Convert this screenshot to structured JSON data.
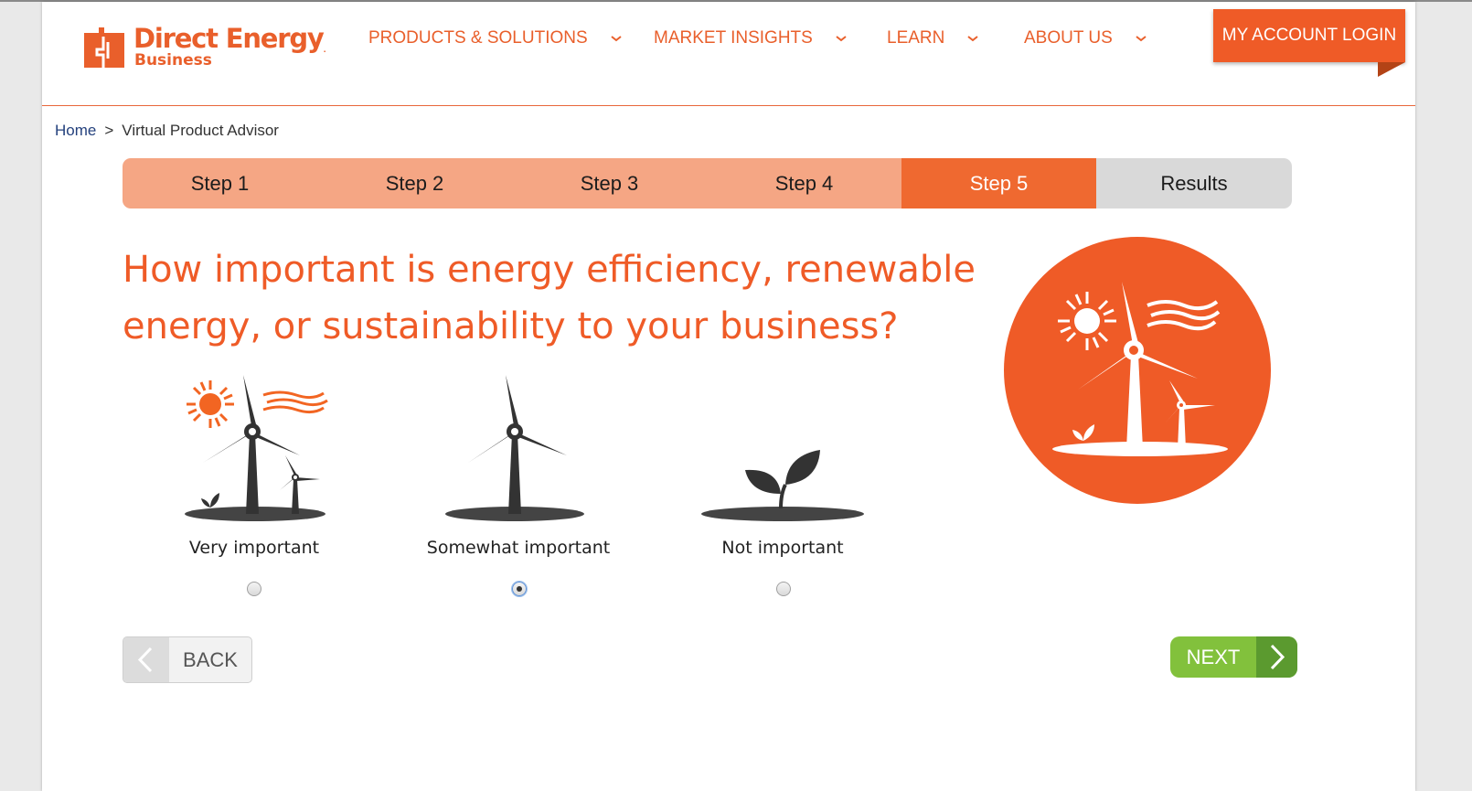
{
  "header": {
    "logo": {
      "name": "Direct Energy",
      "sub": "Business",
      "trademark": "."
    },
    "nav": [
      {
        "label": "PRODUCTS & SOLUTIONS"
      },
      {
        "label": "MARKET INSIGHTS"
      },
      {
        "label": "LEARN"
      },
      {
        "label": "ABOUT US"
      }
    ],
    "account_button": "MY ACCOUNT LOGIN"
  },
  "breadcrumb": {
    "home": "Home",
    "separator": ">",
    "current": "Virtual Product Advisor"
  },
  "steps": [
    {
      "label": "Step 1",
      "state": "completed"
    },
    {
      "label": "Step 2",
      "state": "completed"
    },
    {
      "label": "Step 3",
      "state": "completed"
    },
    {
      "label": "Step 4",
      "state": "completed"
    },
    {
      "label": "Step 5",
      "state": "active"
    },
    {
      "label": "Results",
      "state": "upcoming"
    }
  ],
  "question": "How important is energy efficiency, renewable energy, or sustainability to your business?",
  "options": [
    {
      "label": "Very important",
      "icon": "sun-wind-turbines-icon",
      "selected": false
    },
    {
      "label": "Somewhat important",
      "icon": "wind-turbine-icon",
      "selected": true
    },
    {
      "label": "Not important",
      "icon": "sprout-icon",
      "selected": false
    }
  ],
  "hero_icon": "renewable-energy-badge-icon",
  "buttons": {
    "back": "BACK",
    "next": "NEXT"
  },
  "colors": {
    "brand_orange": "#ef5b27",
    "step_completed": "#f5a684",
    "step_active": "#ef6930",
    "step_upcoming": "#d9d9d9",
    "next_green": "#82c13c",
    "link_blue": "#24417d"
  }
}
